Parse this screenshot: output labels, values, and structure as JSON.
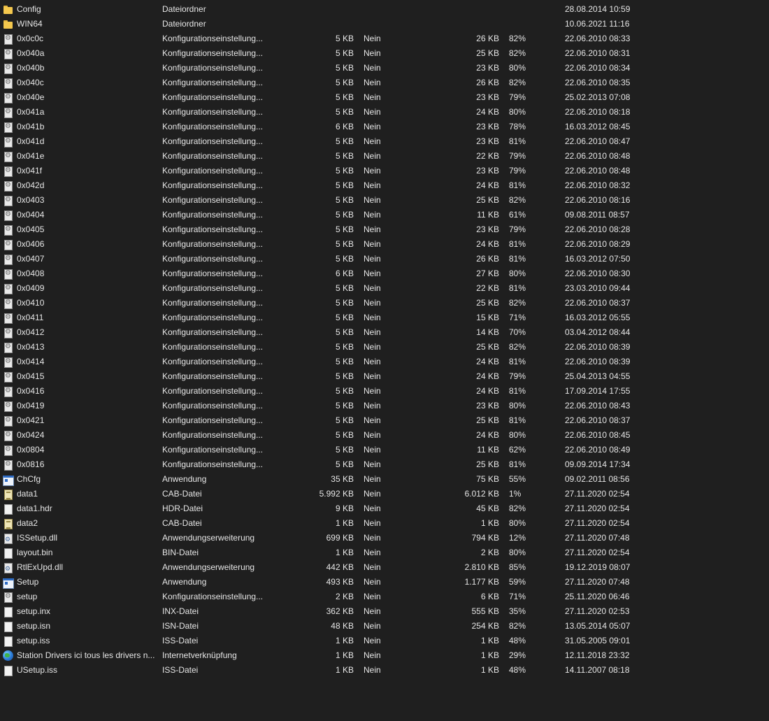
{
  "files": [
    {
      "name": "Config",
      "type": "Dateiordner",
      "size": "",
      "protected": "",
      "compressed": "",
      "ratio": "",
      "modified": "28.08.2014 10:59",
      "icon": "folder"
    },
    {
      "name": "WIN64",
      "type": "Dateiordner",
      "size": "",
      "protected": "",
      "compressed": "",
      "ratio": "",
      "modified": "10.06.2021 11:16",
      "icon": "folder"
    },
    {
      "name": "0x0c0c",
      "type": "Konfigurationseinstellung...",
      "size": "5 KB",
      "protected": "Nein",
      "compressed": "26 KB",
      "ratio": "82%",
      "modified": "22.06.2010 08:33",
      "icon": "cfg"
    },
    {
      "name": "0x040a",
      "type": "Konfigurationseinstellung...",
      "size": "5 KB",
      "protected": "Nein",
      "compressed": "25 KB",
      "ratio": "82%",
      "modified": "22.06.2010 08:31",
      "icon": "cfg"
    },
    {
      "name": "0x040b",
      "type": "Konfigurationseinstellung...",
      "size": "5 KB",
      "protected": "Nein",
      "compressed": "23 KB",
      "ratio": "80%",
      "modified": "22.06.2010 08:34",
      "icon": "cfg"
    },
    {
      "name": "0x040c",
      "type": "Konfigurationseinstellung...",
      "size": "5 KB",
      "protected": "Nein",
      "compressed": "26 KB",
      "ratio": "82%",
      "modified": "22.06.2010 08:35",
      "icon": "cfg"
    },
    {
      "name": "0x040e",
      "type": "Konfigurationseinstellung...",
      "size": "5 KB",
      "protected": "Nein",
      "compressed": "23 KB",
      "ratio": "79%",
      "modified": "25.02.2013 07:08",
      "icon": "cfg"
    },
    {
      "name": "0x041a",
      "type": "Konfigurationseinstellung...",
      "size": "5 KB",
      "protected": "Nein",
      "compressed": "24 KB",
      "ratio": "80%",
      "modified": "22.06.2010 08:18",
      "icon": "cfg"
    },
    {
      "name": "0x041b",
      "type": "Konfigurationseinstellung...",
      "size": "6 KB",
      "protected": "Nein",
      "compressed": "23 KB",
      "ratio": "78%",
      "modified": "16.03.2012 08:45",
      "icon": "cfg"
    },
    {
      "name": "0x041d",
      "type": "Konfigurationseinstellung...",
      "size": "5 KB",
      "protected": "Nein",
      "compressed": "23 KB",
      "ratio": "81%",
      "modified": "22.06.2010 08:47",
      "icon": "cfg"
    },
    {
      "name": "0x041e",
      "type": "Konfigurationseinstellung...",
      "size": "5 KB",
      "protected": "Nein",
      "compressed": "22 KB",
      "ratio": "79%",
      "modified": "22.06.2010 08:48",
      "icon": "cfg"
    },
    {
      "name": "0x041f",
      "type": "Konfigurationseinstellung...",
      "size": "5 KB",
      "protected": "Nein",
      "compressed": "23 KB",
      "ratio": "79%",
      "modified": "22.06.2010 08:48",
      "icon": "cfg"
    },
    {
      "name": "0x042d",
      "type": "Konfigurationseinstellung...",
      "size": "5 KB",
      "protected": "Nein",
      "compressed": "24 KB",
      "ratio": "81%",
      "modified": "22.06.2010 08:32",
      "icon": "cfg"
    },
    {
      "name": "0x0403",
      "type": "Konfigurationseinstellung...",
      "size": "5 KB",
      "protected": "Nein",
      "compressed": "25 KB",
      "ratio": "82%",
      "modified": "22.06.2010 08:16",
      "icon": "cfg"
    },
    {
      "name": "0x0404",
      "type": "Konfigurationseinstellung...",
      "size": "5 KB",
      "protected": "Nein",
      "compressed": "11 KB",
      "ratio": "61%",
      "modified": "09.08.2011 08:57",
      "icon": "cfg"
    },
    {
      "name": "0x0405",
      "type": "Konfigurationseinstellung...",
      "size": "5 KB",
      "protected": "Nein",
      "compressed": "23 KB",
      "ratio": "79%",
      "modified": "22.06.2010 08:28",
      "icon": "cfg"
    },
    {
      "name": "0x0406",
      "type": "Konfigurationseinstellung...",
      "size": "5 KB",
      "protected": "Nein",
      "compressed": "24 KB",
      "ratio": "81%",
      "modified": "22.06.2010 08:29",
      "icon": "cfg"
    },
    {
      "name": "0x0407",
      "type": "Konfigurationseinstellung...",
      "size": "5 KB",
      "protected": "Nein",
      "compressed": "26 KB",
      "ratio": "81%",
      "modified": "16.03.2012 07:50",
      "icon": "cfg"
    },
    {
      "name": "0x0408",
      "type": "Konfigurationseinstellung...",
      "size": "6 KB",
      "protected": "Nein",
      "compressed": "27 KB",
      "ratio": "80%",
      "modified": "22.06.2010 08:30",
      "icon": "cfg"
    },
    {
      "name": "0x0409",
      "type": "Konfigurationseinstellung...",
      "size": "5 KB",
      "protected": "Nein",
      "compressed": "22 KB",
      "ratio": "81%",
      "modified": "23.03.2010 09:44",
      "icon": "cfg"
    },
    {
      "name": "0x0410",
      "type": "Konfigurationseinstellung...",
      "size": "5 KB",
      "protected": "Nein",
      "compressed": "25 KB",
      "ratio": "82%",
      "modified": "22.06.2010 08:37",
      "icon": "cfg"
    },
    {
      "name": "0x0411",
      "type": "Konfigurationseinstellung...",
      "size": "5 KB",
      "protected": "Nein",
      "compressed": "15 KB",
      "ratio": "71%",
      "modified": "16.03.2012 05:55",
      "icon": "cfg"
    },
    {
      "name": "0x0412",
      "type": "Konfigurationseinstellung...",
      "size": "5 KB",
      "protected": "Nein",
      "compressed": "14 KB",
      "ratio": "70%",
      "modified": "03.04.2012 08:44",
      "icon": "cfg"
    },
    {
      "name": "0x0413",
      "type": "Konfigurationseinstellung...",
      "size": "5 KB",
      "protected": "Nein",
      "compressed": "25 KB",
      "ratio": "82%",
      "modified": "22.06.2010 08:39",
      "icon": "cfg"
    },
    {
      "name": "0x0414",
      "type": "Konfigurationseinstellung...",
      "size": "5 KB",
      "protected": "Nein",
      "compressed": "24 KB",
      "ratio": "81%",
      "modified": "22.06.2010 08:39",
      "icon": "cfg"
    },
    {
      "name": "0x0415",
      "type": "Konfigurationseinstellung...",
      "size": "5 KB",
      "protected": "Nein",
      "compressed": "24 KB",
      "ratio": "79%",
      "modified": "25.04.2013 04:55",
      "icon": "cfg"
    },
    {
      "name": "0x0416",
      "type": "Konfigurationseinstellung...",
      "size": "5 KB",
      "protected": "Nein",
      "compressed": "24 KB",
      "ratio": "81%",
      "modified": "17.09.2014 17:55",
      "icon": "cfg"
    },
    {
      "name": "0x0419",
      "type": "Konfigurationseinstellung...",
      "size": "5 KB",
      "protected": "Nein",
      "compressed": "23 KB",
      "ratio": "80%",
      "modified": "22.06.2010 08:43",
      "icon": "cfg"
    },
    {
      "name": "0x0421",
      "type": "Konfigurationseinstellung...",
      "size": "5 KB",
      "protected": "Nein",
      "compressed": "25 KB",
      "ratio": "81%",
      "modified": "22.06.2010 08:37",
      "icon": "cfg"
    },
    {
      "name": "0x0424",
      "type": "Konfigurationseinstellung...",
      "size": "5 KB",
      "protected": "Nein",
      "compressed": "24 KB",
      "ratio": "80%",
      "modified": "22.06.2010 08:45",
      "icon": "cfg"
    },
    {
      "name": "0x0804",
      "type": "Konfigurationseinstellung...",
      "size": "5 KB",
      "protected": "Nein",
      "compressed": "11 KB",
      "ratio": "62%",
      "modified": "22.06.2010 08:49",
      "icon": "cfg"
    },
    {
      "name": "0x0816",
      "type": "Konfigurationseinstellung...",
      "size": "5 KB",
      "protected": "Nein",
      "compressed": "25 KB",
      "ratio": "81%",
      "modified": "09.09.2014 17:34",
      "icon": "cfg"
    },
    {
      "name": "ChCfg",
      "type": "Anwendung",
      "size": "35 KB",
      "protected": "Nein",
      "compressed": "75 KB",
      "ratio": "55%",
      "modified": "09.02.2011 08:56",
      "icon": "app"
    },
    {
      "name": "data1",
      "type": "CAB-Datei",
      "size": "5.992 KB",
      "protected": "Nein",
      "compressed": "6.012 KB",
      "ratio": "1%",
      "modified": "27.11.2020 02:54",
      "icon": "cab"
    },
    {
      "name": "data1.hdr",
      "type": "HDR-Datei",
      "size": "9 KB",
      "protected": "Nein",
      "compressed": "45 KB",
      "ratio": "82%",
      "modified": "27.11.2020 02:54",
      "icon": "doc"
    },
    {
      "name": "data2",
      "type": "CAB-Datei",
      "size": "1 KB",
      "protected": "Nein",
      "compressed": "1 KB",
      "ratio": "80%",
      "modified": "27.11.2020 02:54",
      "icon": "cab"
    },
    {
      "name": "ISSetup.dll",
      "type": "Anwendungserweiterung",
      "size": "699 KB",
      "protected": "Nein",
      "compressed": "794 KB",
      "ratio": "12%",
      "modified": "27.11.2020 07:48",
      "icon": "dll"
    },
    {
      "name": "layout.bin",
      "type": "BIN-Datei",
      "size": "1 KB",
      "protected": "Nein",
      "compressed": "2 KB",
      "ratio": "80%",
      "modified": "27.11.2020 02:54",
      "icon": "doc"
    },
    {
      "name": "RtlExUpd.dll",
      "type": "Anwendungserweiterung",
      "size": "442 KB",
      "protected": "Nein",
      "compressed": "2.810 KB",
      "ratio": "85%",
      "modified": "19.12.2019 08:07",
      "icon": "dll"
    },
    {
      "name": "Setup",
      "type": "Anwendung",
      "size": "493 KB",
      "protected": "Nein",
      "compressed": "1.177 KB",
      "ratio": "59%",
      "modified": "27.11.2020 07:48",
      "icon": "app"
    },
    {
      "name": "setup",
      "type": "Konfigurationseinstellung...",
      "size": "2 KB",
      "protected": "Nein",
      "compressed": "6 KB",
      "ratio": "71%",
      "modified": "25.11.2020 06:46",
      "icon": "cfg"
    },
    {
      "name": "setup.inx",
      "type": "INX-Datei",
      "size": "362 KB",
      "protected": "Nein",
      "compressed": "555 KB",
      "ratio": "35%",
      "modified": "27.11.2020 02:53",
      "icon": "doc"
    },
    {
      "name": "setup.isn",
      "type": "ISN-Datei",
      "size": "48 KB",
      "protected": "Nein",
      "compressed": "254 KB",
      "ratio": "82%",
      "modified": "13.05.2014 05:07",
      "icon": "doc"
    },
    {
      "name": "setup.iss",
      "type": "ISS-Datei",
      "size": "1 KB",
      "protected": "Nein",
      "compressed": "1 KB",
      "ratio": "48%",
      "modified": "31.05.2005 09:01",
      "icon": "doc"
    },
    {
      "name": "Station Drivers ici tous les drivers n...",
      "type": "Internetverknüpfung",
      "size": "1 KB",
      "protected": "Nein",
      "compressed": "1 KB",
      "ratio": "29%",
      "modified": "12.11.2018 23:32",
      "icon": "globe"
    },
    {
      "name": "USetup.iss",
      "type": "ISS-Datei",
      "size": "1 KB",
      "protected": "Nein",
      "compressed": "1 KB",
      "ratio": "48%",
      "modified": "14.11.2007 08:18",
      "icon": "doc"
    }
  ]
}
